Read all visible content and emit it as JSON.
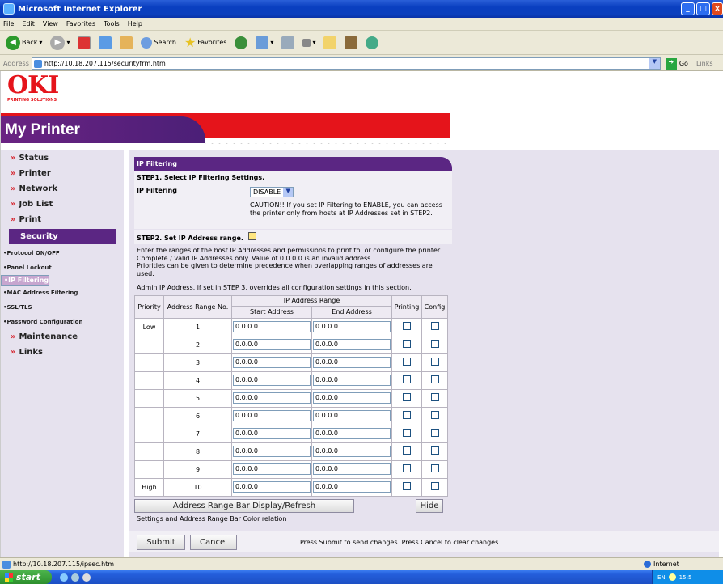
{
  "window": {
    "title": "Microsoft Internet Explorer"
  },
  "menu": [
    "File",
    "Edit",
    "View",
    "Favorites",
    "Tools",
    "Help"
  ],
  "toolbar": {
    "back": "Back",
    "search": "Search",
    "favorites": "Favorites"
  },
  "address": {
    "label": "Address",
    "url": "http://10.18.207.115/securityfrm.htm",
    "go": "Go",
    "links": "Links"
  },
  "brand": {
    "logo": "OKI",
    "tagline": "PRINTING SOLUTIONS",
    "title": "My Printer"
  },
  "nav": {
    "main": [
      {
        "label": "Status"
      },
      {
        "label": "Printer"
      },
      {
        "label": "Network"
      },
      {
        "label": "Job List"
      },
      {
        "label": "Print"
      }
    ],
    "selected": "Security",
    "sub": [
      {
        "label": "•Protocol ON/OFF"
      },
      {
        "label": "•Panel Lockout"
      },
      {
        "label": "•IP Filtering"
      },
      {
        "label": "•MAC Address Filtering"
      },
      {
        "label": "•SSL/TLS"
      },
      {
        "label": "•Password Configuration"
      }
    ],
    "after": [
      {
        "label": "Maintenance"
      },
      {
        "label": "Links"
      }
    ]
  },
  "panel": {
    "title": "IP Filtering",
    "step1": "STEP1. Select IP Filtering Settings.",
    "ipf_label": "IP Filtering",
    "ipf_value": "DISABLE",
    "caution": "CAUTION!! If you set IP Filtering to ENABLE, you can access the printer only from hosts at IP Addresses set in STEP2.",
    "step2": "STEP2. Set IP Address range.",
    "desc1": "Enter the ranges of the host IP Addresses and permissions to print to, or configure the printer.",
    "desc2": "Complete / valid IP Addresses only. Value of 0.0.0.0 is an invalid address.",
    "desc3": "Priorities can be given to determine precedence when overlapping ranges of addresses are used.",
    "desc4": "Admin IP Address, if set in STEP 3, overrides all configuration settings in this section."
  },
  "table": {
    "h_priority": "Priority",
    "h_arn": "Address Range No.",
    "h_range": "IP Address Range",
    "h_start": "Start Address",
    "h_end": "End Address",
    "h_print": "Printing",
    "h_config": "Config",
    "rows": [
      {
        "p": "Low",
        "n": "1",
        "s": "0.0.0.0",
        "e": "0.0.0.0"
      },
      {
        "p": "",
        "n": "2",
        "s": "0.0.0.0",
        "e": "0.0.0.0"
      },
      {
        "p": "",
        "n": "3",
        "s": "0.0.0.0",
        "e": "0.0.0.0"
      },
      {
        "p": "",
        "n": "4",
        "s": "0.0.0.0",
        "e": "0.0.0.0"
      },
      {
        "p": "",
        "n": "5",
        "s": "0.0.0.0",
        "e": "0.0.0.0"
      },
      {
        "p": "",
        "n": "6",
        "s": "0.0.0.0",
        "e": "0.0.0.0"
      },
      {
        "p": "",
        "n": "7",
        "s": "0.0.0.0",
        "e": "0.0.0.0"
      },
      {
        "p": "",
        "n": "8",
        "s": "0.0.0.0",
        "e": "0.0.0.0"
      },
      {
        "p": "",
        "n": "9",
        "s": "0.0.0.0",
        "e": "0.0.0.0"
      },
      {
        "p": "High",
        "n": "10",
        "s": "0.0.0.0",
        "e": "0.0.0.0"
      }
    ]
  },
  "actions": {
    "refresh": "Address Range Bar Display/Refresh",
    "hide": "Hide",
    "color_relation": "Settings and Address Range Bar Color relation",
    "submit": "Submit",
    "cancel": "Cancel",
    "hint": "Press Submit to send changes. Press Cancel to clear changes."
  },
  "status": {
    "url": "http://10.18.207.115/ipsec.htm",
    "zone": "Internet"
  },
  "taskbar": {
    "start": "start",
    "lang": "EN",
    "clock": "15:5"
  }
}
